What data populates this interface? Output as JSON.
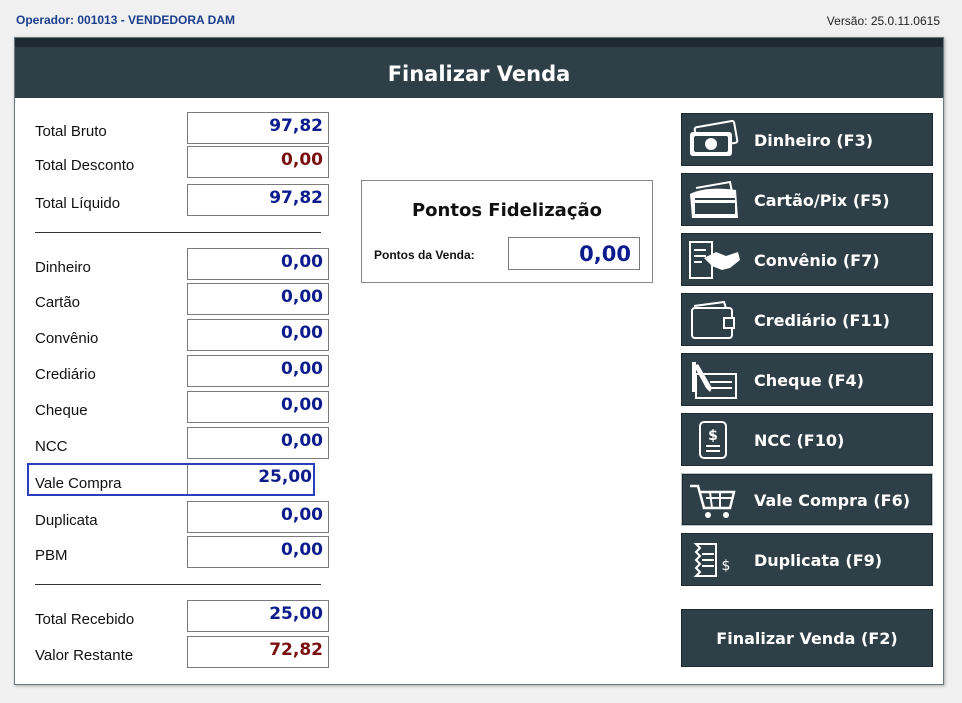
{
  "header": {
    "operator": "Operador: 001013 - VENDEDORA DAM",
    "version": "Versão: 25.0.11.0615"
  },
  "window": {
    "title": "Finalizar Venda"
  },
  "totals_top": [
    {
      "label": "Total Bruto",
      "value": "97,82",
      "color": "blue"
    },
    {
      "label": "Total Desconto",
      "value": "0,00",
      "color": "red"
    },
    {
      "label": "Total Líquido",
      "value": "97,82",
      "color": "blue"
    }
  ],
  "payments": [
    {
      "label": "Dinheiro",
      "value": "0,00"
    },
    {
      "label": "Cartão",
      "value": "0,00"
    },
    {
      "label": "Convênio",
      "value": "0,00"
    },
    {
      "label": "Crediário",
      "value": "0,00"
    },
    {
      "label": "Cheque",
      "value": "0,00"
    },
    {
      "label": "NCC",
      "value": "0,00"
    },
    {
      "label": "Vale Compra",
      "value": "25,00"
    },
    {
      "label": "Duplicata",
      "value": "0,00"
    },
    {
      "label": "PBM",
      "value": "0,00"
    }
  ],
  "totals_bottom": [
    {
      "label": "Total Recebido",
      "value": "25,00",
      "color": "blue"
    },
    {
      "label": "Valor Restante",
      "value": "72,82",
      "color": "red"
    }
  ],
  "points": {
    "title": "Pontos Fidelização",
    "label": "Pontos da Venda:",
    "value": "0,00"
  },
  "buttons": [
    {
      "label": "Dinheiro (F3)",
      "icon": "cash-icon"
    },
    {
      "label": "Cartão/Pix (F5)",
      "icon": "card-icon"
    },
    {
      "label": "Convênio (F7)",
      "icon": "handshake-icon"
    },
    {
      "label": "Crediário (F11)",
      "icon": "wallet-icon"
    },
    {
      "label": "Cheque (F4)",
      "icon": "check-pen-icon"
    },
    {
      "label": "NCC (F10)",
      "icon": "receipt-icon"
    },
    {
      "label": "Vale Compra (F6)",
      "icon": "cart-icon"
    },
    {
      "label": "Duplicata (F9)",
      "icon": "bill-icon"
    }
  ],
  "final_button": "Finalizar Venda (F2)",
  "colors": {
    "header": "#2f3f48",
    "value_blue": "#0d1c8c",
    "value_red": "#7a0f0f",
    "selection": "#2a3fc0"
  }
}
